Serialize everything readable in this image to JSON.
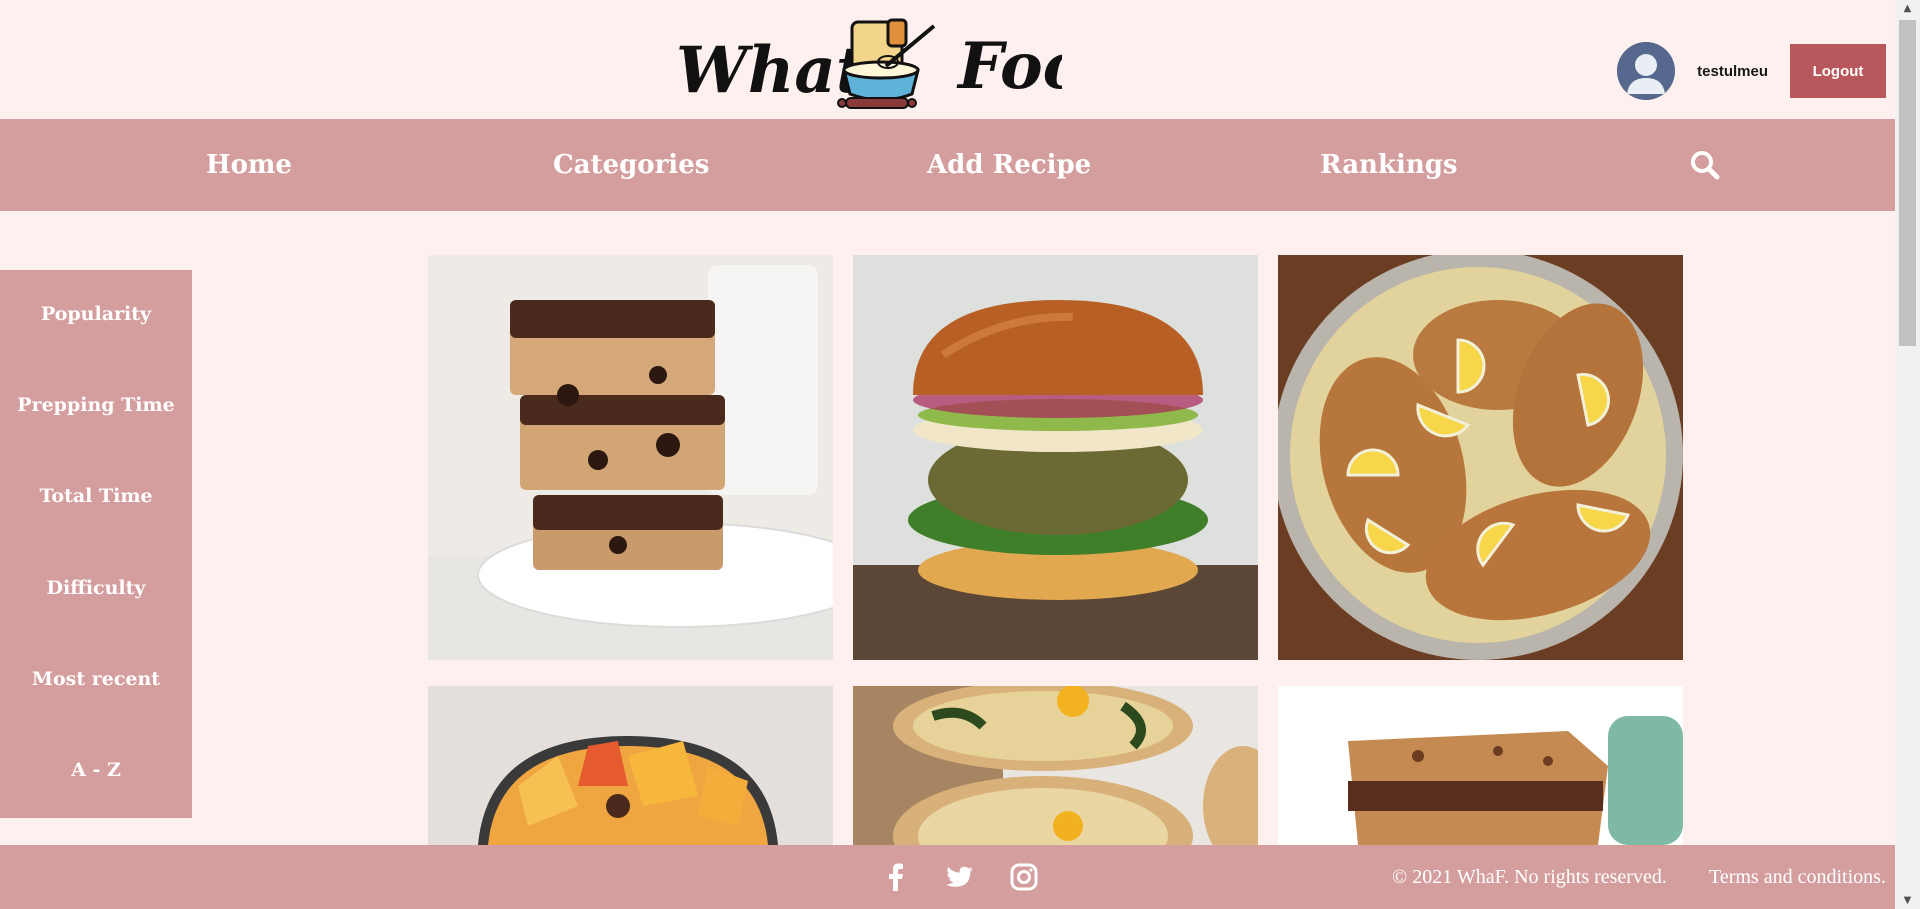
{
  "header": {
    "logo_text_left": "What",
    "logo_text_right": "Food",
    "username": "testulmeu",
    "logout_label": "Logout"
  },
  "nav": {
    "items": [
      "Home",
      "Categories",
      "Add Recipe",
      "Rankings"
    ],
    "search_icon": "search-icon"
  },
  "sidebar": {
    "sort_options": [
      "Popularity",
      "Prepping Time",
      "Total Time",
      "Difficulty",
      "Most recent",
      "A - Z"
    ]
  },
  "recipes": [
    {
      "image": "chocolate-chip-bars"
    },
    {
      "image": "veggie-burger"
    },
    {
      "image": "chicken-piccata"
    },
    {
      "image": "peach-bowl"
    },
    {
      "image": "egg-toast"
    },
    {
      "image": "blondie-bars"
    }
  ],
  "footer": {
    "social_icons": [
      "facebook-icon",
      "twitter-icon",
      "instagram-icon"
    ],
    "copyright": "© 2021 WhaF. No rights reserved.",
    "terms_label": "Terms and conditions."
  },
  "colors": {
    "background": "#fff0f0",
    "nav": "#d49e9f",
    "logout": "#b8575c"
  }
}
